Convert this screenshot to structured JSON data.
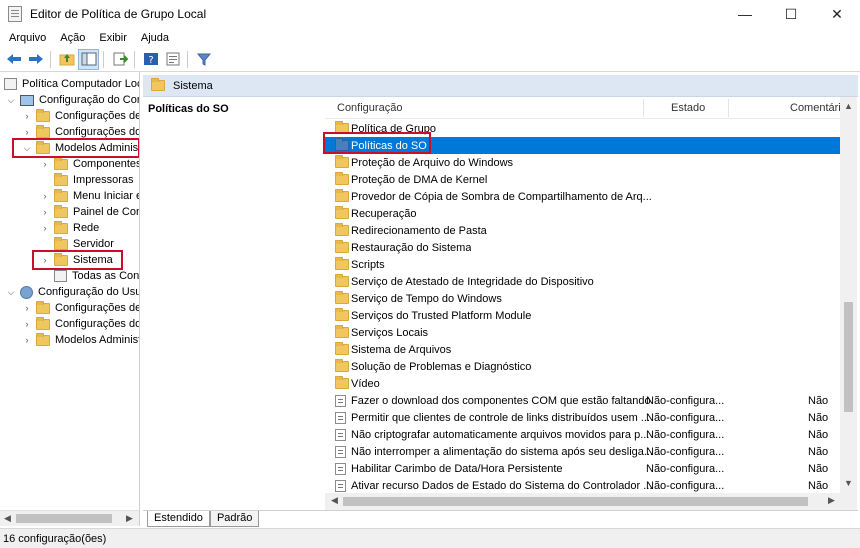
{
  "window": {
    "title": "Editor de Política de Grupo Local",
    "icon": "gpedit-icon",
    "controls": [
      "—",
      "☐",
      "✕"
    ]
  },
  "menu": [
    "Arquivo",
    "Ação",
    "Exibir",
    "Ajuda"
  ],
  "toolbar_icons": [
    "back-arrow-icon",
    "forward-arrow-icon",
    "up-folder-icon",
    "show-hide-tree-icon",
    "export-list-icon",
    "help-icon",
    "properties-icon",
    "filter-icon"
  ],
  "tree": {
    "items": [
      {
        "label": "Política Computador Local",
        "icon": "policy-icon",
        "expander": ""
      },
      {
        "label": "Configuração do Computador",
        "icon": "computer-icon",
        "expander": "v"
      },
      {
        "label": "Configurações de Software",
        "icon": "folder-icon",
        "expander": ">"
      },
      {
        "label": "Configurações do Windows",
        "icon": "folder-icon",
        "expander": ">"
      },
      {
        "label": "Modelos Administrativos",
        "icon": "folder-icon",
        "expander": "v"
      },
      {
        "label": "Componentes do Windows",
        "icon": "folder-icon",
        "expander": ">"
      },
      {
        "label": "Impressoras",
        "icon": "folder-icon",
        "expander": ""
      },
      {
        "label": "Menu Iniciar e Barra de Tarefas",
        "icon": "folder-icon",
        "expander": ">"
      },
      {
        "label": "Painel de Controle",
        "icon": "folder-icon",
        "expander": ">"
      },
      {
        "label": "Rede",
        "icon": "folder-icon",
        "expander": ">"
      },
      {
        "label": "Servidor",
        "icon": "folder-icon",
        "expander": ""
      },
      {
        "label": "Sistema",
        "icon": "folder-icon",
        "expander": ">"
      },
      {
        "label": "Todas as Configurações",
        "icon": "all-settings-icon",
        "expander": ""
      },
      {
        "label": "Configuração do Usuário",
        "icon": "user-icon",
        "expander": "v"
      },
      {
        "label": "Configurações de Software",
        "icon": "folder-icon",
        "expander": ">"
      },
      {
        "label": "Configurações do Windows",
        "icon": "folder-icon",
        "expander": ">"
      },
      {
        "label": "Modelos Administrativos",
        "icon": "folder-icon",
        "expander": ">"
      }
    ]
  },
  "right_header": {
    "title": "Sistema"
  },
  "description": {
    "title": "Políticas do SO"
  },
  "columns": {
    "name": "Configuração",
    "state": "Estado",
    "comment": "Comentário"
  },
  "list": [
    {
      "name": "Política de Grupo",
      "type": "folder",
      "state": "",
      "comment": ""
    },
    {
      "name": "Políticas do SO",
      "type": "folder",
      "state": "",
      "comment": "",
      "selected": true
    },
    {
      "name": "Proteção de Arquivo do Windows",
      "type": "folder",
      "state": "",
      "comment": ""
    },
    {
      "name": "Proteção de DMA de Kernel",
      "type": "folder",
      "state": "",
      "comment": ""
    },
    {
      "name": "Provedor de Cópia de Sombra de Compartilhamento de Arq...",
      "type": "folder",
      "state": "",
      "comment": ""
    },
    {
      "name": "Recuperação",
      "type": "folder",
      "state": "",
      "comment": ""
    },
    {
      "name": "Redirecionamento de Pasta",
      "type": "folder",
      "state": "",
      "comment": ""
    },
    {
      "name": "Restauração do Sistema",
      "type": "folder",
      "state": "",
      "comment": ""
    },
    {
      "name": "Scripts",
      "type": "folder",
      "state": "",
      "comment": ""
    },
    {
      "name": "Serviço de Atestado de Integridade do Dispositivo",
      "type": "folder",
      "state": "",
      "comment": ""
    },
    {
      "name": "Serviço de Tempo do Windows",
      "type": "folder",
      "state": "",
      "comment": ""
    },
    {
      "name": "Serviços do Trusted Platform Module",
      "type": "folder",
      "state": "",
      "comment": ""
    },
    {
      "name": "Serviços Locais",
      "type": "folder",
      "state": "",
      "comment": ""
    },
    {
      "name": "Sistema de Arquivos",
      "type": "folder",
      "state": "",
      "comment": ""
    },
    {
      "name": "Solução de Problemas e Diagnóstico",
      "type": "folder",
      "state": "",
      "comment": ""
    },
    {
      "name": "Vídeo",
      "type": "folder",
      "state": "",
      "comment": ""
    },
    {
      "name": "Fazer o download dos componentes COM que estão faltando",
      "type": "setting",
      "state": "Não-configura...",
      "comment": "Não"
    },
    {
      "name": "Permitir que clientes de controle de links distribuídos usem ...",
      "type": "setting",
      "state": "Não-configura...",
      "comment": "Não"
    },
    {
      "name": "Não criptografar automaticamente arquivos movidos para p...",
      "type": "setting",
      "state": "Não-configura...",
      "comment": "Não"
    },
    {
      "name": "Não interromper a alimentação do sistema após seu desliga...",
      "type": "setting",
      "state": "Não-configura...",
      "comment": "Não"
    },
    {
      "name": "Habilitar Carimbo de Data/Hora Persistente",
      "type": "setting",
      "state": "Não-configura...",
      "comment": "Não"
    },
    {
      "name": "Ativar recurso Dados de Estado do Sistema do Controlador ...",
      "type": "setting",
      "state": "Não-configura...",
      "comment": "Não"
    }
  ],
  "tabs": [
    "Estendido",
    "Padrão"
  ],
  "status": "16 configuração(ões)",
  "colors": {
    "selection": "#0078d7",
    "highlight_box": "#c8102e",
    "header_bg": "#dde7f3",
    "folder": "#f0c75e"
  }
}
